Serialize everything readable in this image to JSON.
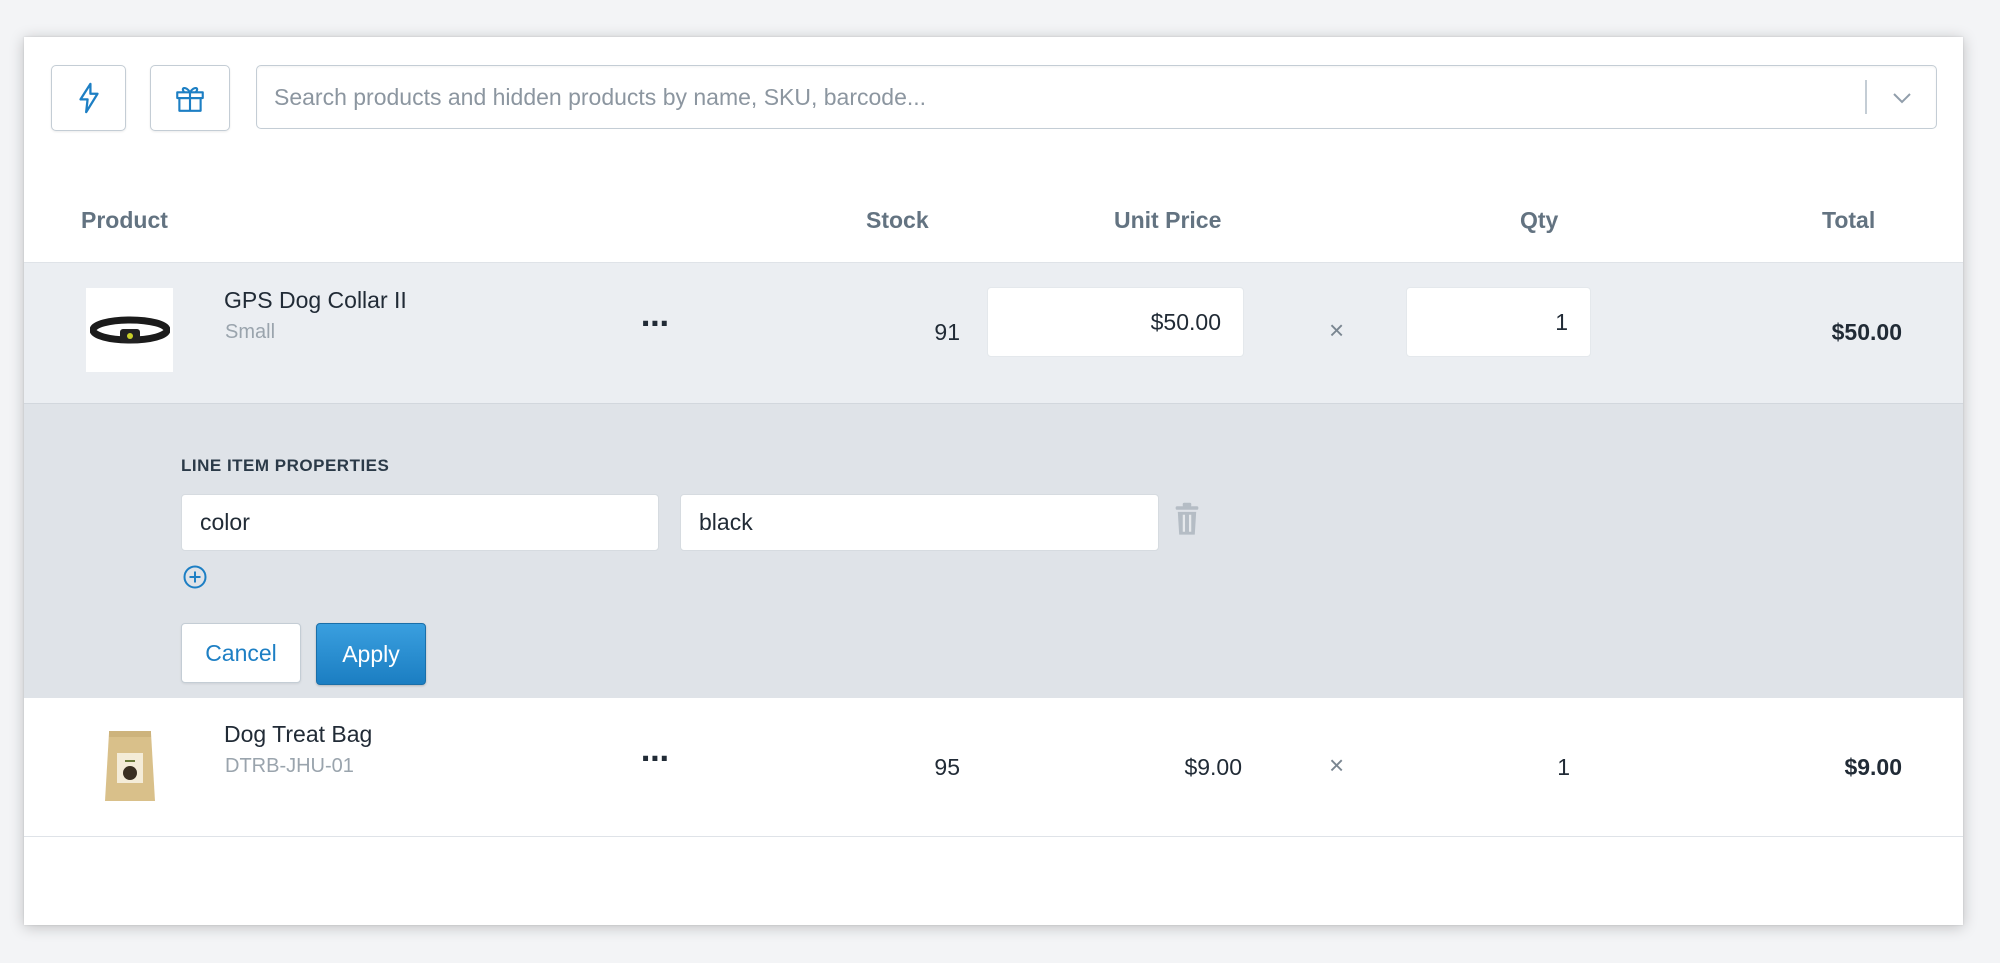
{
  "toolbar": {
    "quick_icon": "lightning-icon",
    "gift_icon": "gift-icon",
    "search_placeholder": "Search products and hidden products by name, SKU, barcode..."
  },
  "table": {
    "headers": {
      "product": "Product",
      "stock": "Stock",
      "unit_price": "Unit Price",
      "qty": "Qty",
      "total": "Total"
    },
    "rows": [
      {
        "name": "GPS Dog Collar II",
        "subtitle": "Small",
        "more": "⋯",
        "stock": "91",
        "unit_price": "$50.00",
        "times": "×",
        "qty": "1",
        "total": "$50.00"
      },
      {
        "name": "Dog Treat Bag",
        "subtitle": "DTRB-JHU-01",
        "more": "⋯",
        "stock": "95",
        "unit_price": "$9.00",
        "times": "×",
        "qty": "1",
        "total": "$9.00"
      }
    ]
  },
  "line_item_properties": {
    "title": "LINE ITEM PROPERTIES",
    "key": "color",
    "value": "black",
    "cancel_label": "Cancel",
    "apply_label": "Apply"
  },
  "colors": {
    "accent": "#1d7fc4",
    "apply_bg": "#2a8fd3",
    "selected_row": "#ebeef2",
    "properties_panel": "#dfe3e8"
  }
}
